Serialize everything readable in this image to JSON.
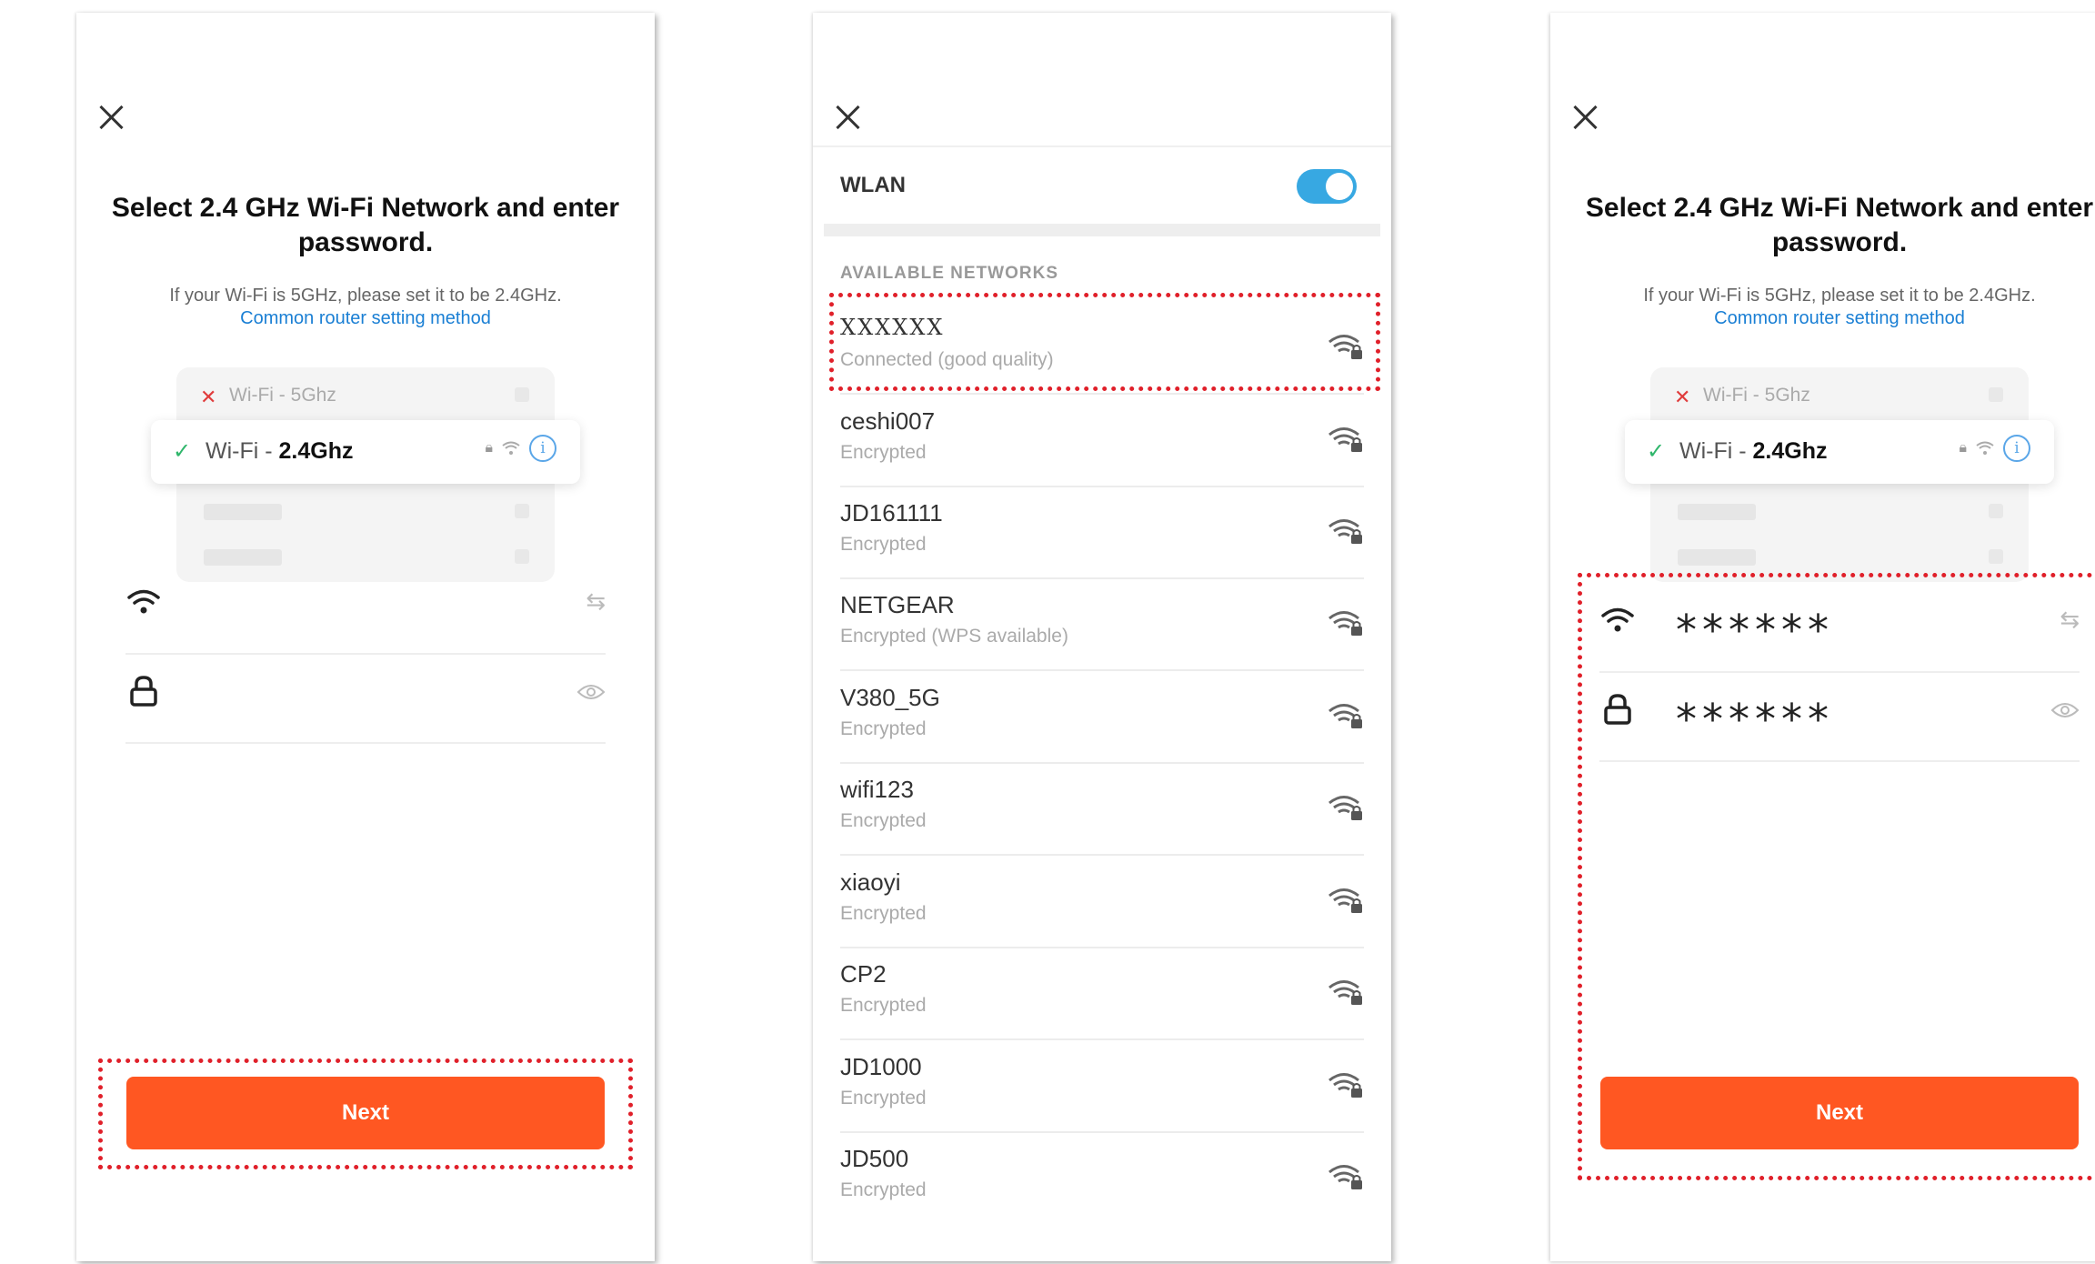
{
  "setup": {
    "title": "Select 2.4 GHz Wi-Fi Network and enter password.",
    "hint": "If your Wi-Fi is 5GHz, please set it to be 2.4GHz.",
    "link": "Common router setting method",
    "band_5": "Wi-Fi - 5Ghz",
    "band_24_prefix": "Wi-Fi - ",
    "band_24_bold": "2.4Ghz",
    "next_label": "Next",
    "masked_ssid": "******",
    "masked_password": "******"
  },
  "wlan": {
    "label": "WLAN",
    "toggle_on": true,
    "section": "AVAILABLE NETWORKS",
    "networks": [
      {
        "name": "XXXXXX",
        "status": "Connected (good quality)"
      },
      {
        "name": "ceshi007",
        "status": "Encrypted"
      },
      {
        "name": "JD161111",
        "status": "Encrypted"
      },
      {
        "name": "NETGEAR",
        "status": "Encrypted (WPS available)"
      },
      {
        "name": "V380_5G",
        "status": "Encrypted"
      },
      {
        "name": "wifi123",
        "status": "Encrypted"
      },
      {
        "name": "xiaoyi",
        "status": "Encrypted"
      },
      {
        "name": "CP2",
        "status": "Encrypted"
      },
      {
        "name": "JD1000",
        "status": "Encrypted"
      },
      {
        "name": "JD500",
        "status": "Encrypted"
      }
    ]
  },
  "colors": {
    "accent": "#ff5722",
    "highlight": "#e0202a",
    "link": "#1a7fd4",
    "toggle": "#37a8e2",
    "check": "#2fb66b"
  },
  "icons": [
    "close-icon",
    "wifi-icon",
    "lock-icon",
    "swap-icon",
    "eye-icon",
    "info-icon",
    "signal-lock-icon",
    "check-icon"
  ]
}
